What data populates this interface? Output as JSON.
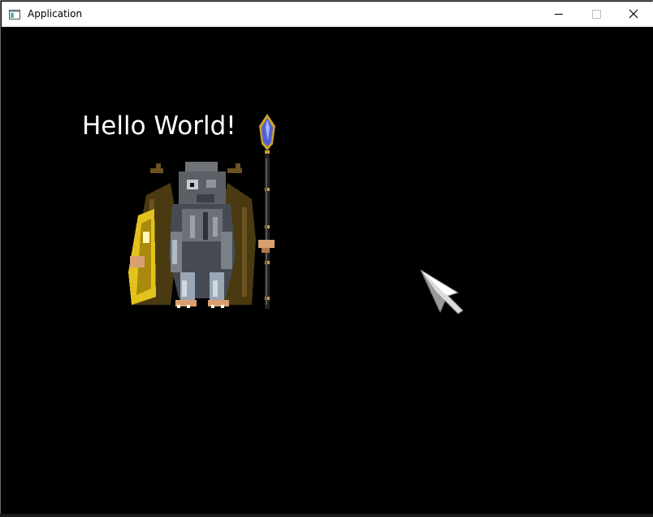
{
  "window": {
    "title": "Application",
    "controls": {
      "minimize": "minimize-icon",
      "maximize": "maximize-icon",
      "close": "close-icon"
    }
  },
  "game": {
    "text": "Hello World!",
    "text_color": "#ffffff",
    "background_color": "#000000",
    "sprite": "horned-mage-with-crystal-staff",
    "cursor": "pixel-arrow-cursor"
  }
}
